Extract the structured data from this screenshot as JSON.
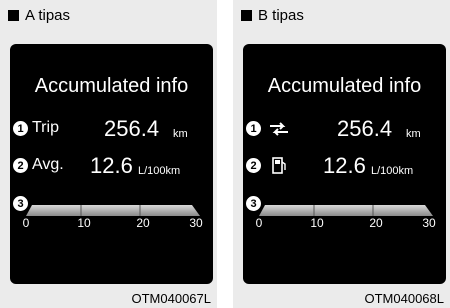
{
  "panels": [
    {
      "header": "A tipas",
      "title": "Accumulated info",
      "badges": [
        "1",
        "2",
        "3"
      ],
      "row1_label": "Trip",
      "row1_value": "256.4",
      "row1_unit": "km",
      "row2_label": "Avg.",
      "row2_value": "12.6",
      "row2_unit": "L/100km",
      "ticks": [
        "0",
        "10",
        "20",
        "30"
      ],
      "code": "OTM040067L"
    },
    {
      "header": "B tipas",
      "title": "Accumulated info",
      "badges": [
        "1",
        "2",
        "3"
      ],
      "row1_icon": "trip-arrows-icon",
      "row1_value": "256.4",
      "row1_unit": "km",
      "row2_icon": "fuel-pump-icon",
      "row2_value": "12.6",
      "row2_unit": "L/100km",
      "ticks": [
        "0",
        "10",
        "20",
        "30"
      ],
      "code": "OTM040068L"
    }
  ],
  "colors": {
    "panel_bg": "#ebebeb",
    "screen_bg": "#000000",
    "text": "#ffffff"
  }
}
